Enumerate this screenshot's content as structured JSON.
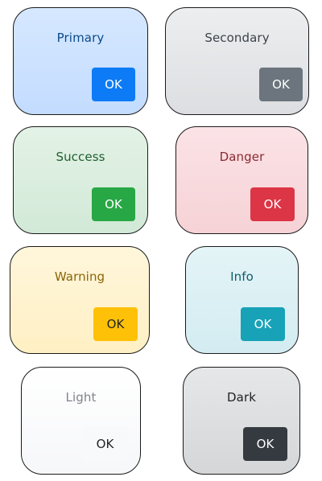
{
  "cards": [
    {
      "id": "primary",
      "title": "Primary",
      "button_label": "OK",
      "colors": {
        "bg_top": "#d6e8ff",
        "bg_bottom": "#c3dcff",
        "title": "#0a4a8c",
        "button_bg": "#0d7bf6",
        "button_text": "#ffffff"
      }
    },
    {
      "id": "secondary",
      "title": "Secondary",
      "button_label": "OK",
      "colors": {
        "bg_top": "#eceef0",
        "bg_bottom": "#dcdee1",
        "title": "#3d4349",
        "button_bg": "#6c757d",
        "button_text": "#ffffff"
      }
    },
    {
      "id": "success",
      "title": "Success",
      "button_label": "OK",
      "colors": {
        "bg_top": "#e3f2e6",
        "bg_bottom": "#d2e9d7",
        "title": "#1f5e2d",
        "button_bg": "#28a745",
        "button_text": "#ffffff"
      }
    },
    {
      "id": "danger",
      "title": "Danger",
      "button_label": "OK",
      "colors": {
        "bg_top": "#fbe3e6",
        "bg_bottom": "#f6d2d6",
        "title": "#8a2a32",
        "button_bg": "#dc3545",
        "button_text": "#ffffff"
      }
    },
    {
      "id": "warning",
      "title": "Warning",
      "button_label": "OK",
      "colors": {
        "bg_top": "#fff6db",
        "bg_bottom": "#fff0c4",
        "title": "#8a6508",
        "button_bg": "#ffc107",
        "button_text": "#212529"
      }
    },
    {
      "id": "info",
      "title": "Info",
      "button_label": "OK",
      "colors": {
        "bg_top": "#e4f4f7",
        "bg_bottom": "#d3ecf1",
        "title": "#0e5d6c",
        "button_bg": "#17a2b8",
        "button_text": "#ffffff"
      }
    },
    {
      "id": "light",
      "title": "Light",
      "button_label": "OK",
      "colors": {
        "bg_top": "#ffffff",
        "bg_bottom": "#f6f7f9",
        "title": "#808489",
        "button_bg": "#f8f9fa",
        "button_text": "#212529"
      }
    },
    {
      "id": "dark",
      "title": "Dark",
      "button_label": "OK",
      "colors": {
        "bg_top": "#e6e7e8",
        "bg_bottom": "#d4d6d8",
        "title": "#1d2124",
        "button_bg": "#343a40",
        "button_text": "#ffffff"
      }
    }
  ]
}
